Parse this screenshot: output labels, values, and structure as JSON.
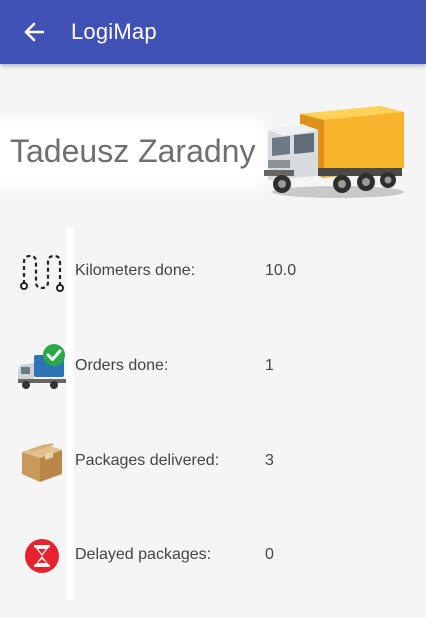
{
  "app_bar": {
    "title": "LogiMap",
    "back_icon": "arrow-back-icon",
    "color": "#3f51b5"
  },
  "profile": {
    "name": "Tadeusz Zaradny",
    "avatar_icon": "truck-icon"
  },
  "stats": [
    {
      "icon": "route-icon",
      "label": "Kilometers done:",
      "value": "10.0"
    },
    {
      "icon": "delivery-truck-check-icon",
      "label": "Orders done:",
      "value": "1"
    },
    {
      "icon": "package-box-icon",
      "label": "Packages delivered:",
      "value": "3"
    },
    {
      "icon": "hourglass-icon",
      "label": "Delayed packages:",
      "value": "0"
    }
  ]
}
